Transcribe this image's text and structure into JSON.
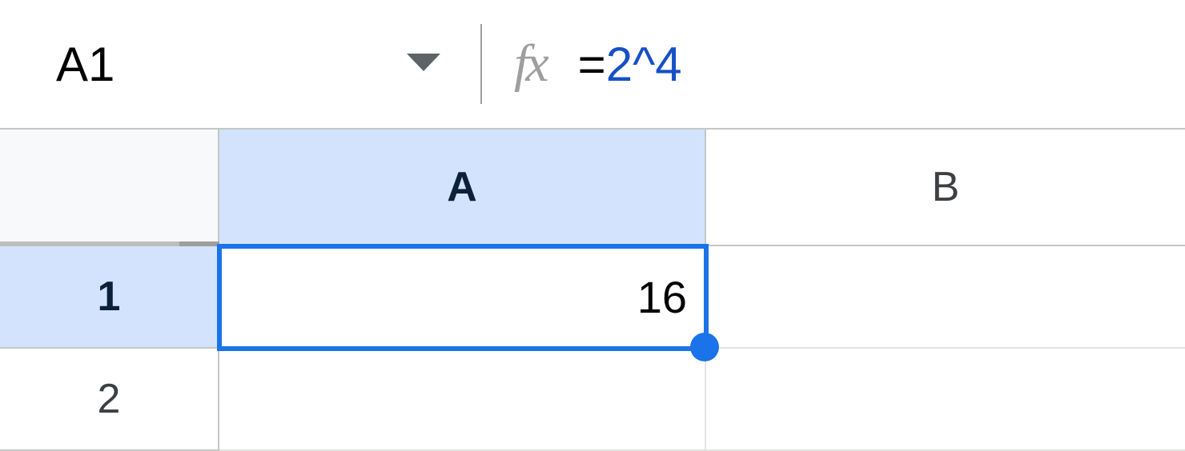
{
  "formula_bar": {
    "cell_reference": "A1",
    "fx_label": "fx",
    "formula_equals": "=",
    "formula_operand1": "2",
    "formula_operator": "^",
    "formula_operand2": "4"
  },
  "grid": {
    "columns": [
      "A",
      "B"
    ],
    "rows": [
      "1",
      "2"
    ],
    "selected_column_index": 0,
    "selected_row_index": 0,
    "cells": {
      "A1": "16",
      "B1": "",
      "A2": "",
      "B2": ""
    }
  }
}
